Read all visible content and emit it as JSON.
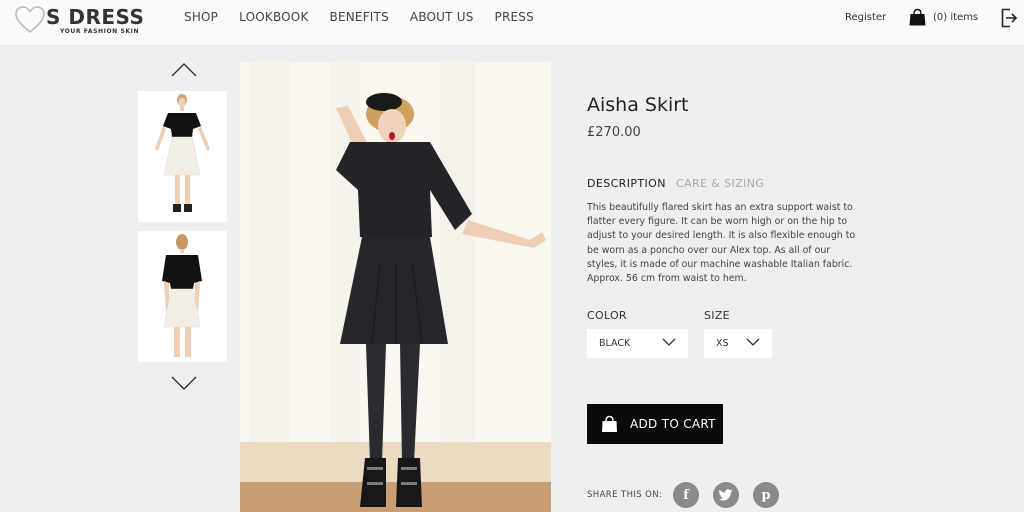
{
  "brand": {
    "name": "S DRESS",
    "tagline": "YOUR FASHION SKIN"
  },
  "nav": [
    "SHOP",
    "LOOKBOOK",
    "BENEFITS",
    "ABOUT US",
    "PRESS"
  ],
  "header": {
    "register": "Register",
    "cart_count": "(0) items"
  },
  "product": {
    "title": "Aisha Skirt",
    "price": "£270.00",
    "tabs": [
      "DESCRIPTION",
      "CARE & SIZING"
    ],
    "description": "This beautifully flared skirt has an extra support waist to flatter every figure. It can be worn high or on the hip to adjust to your desired length. It is also flexible enough to be worn as a poncho over our Alex top. As all of our styles, it is made of our machine washable Italian fabric. Approx. 56 cm from waist to hem.",
    "color_label": "COLOR",
    "color_value": "BLACK",
    "size_label": "SIZE",
    "size_value": "XS",
    "add_to_cart": "ADD TO CART",
    "share_label": "SHARE THIS ON:"
  },
  "colors": {
    "button_bg": "#0a0a0a",
    "social_bg": "#8a8a8a",
    "page_bg": "#efefef",
    "inactive_tab": "#aaaaaa"
  },
  "icons": [
    "heart-logo-icon",
    "shopping-bag-icon",
    "logout-icon",
    "chevron-up-icon",
    "chevron-down-icon",
    "facebook-icon",
    "twitter-icon",
    "pinterest-icon"
  ]
}
